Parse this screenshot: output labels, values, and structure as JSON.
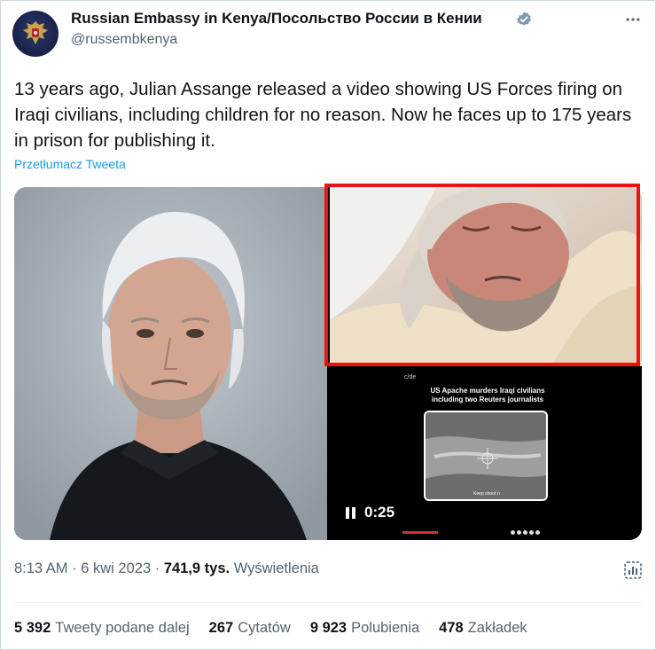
{
  "account": {
    "name": "Russian Embassy in Kenya/Посольство России в Кении",
    "handle": "@russembkenya",
    "verified_color": "#829aab"
  },
  "tweet": {
    "text": "13 years ago, Julian Assange released a video showing US Forces firing on Iraqi civilians, including children for no reason. Now he faces up to 175 years in prison for publishing it.",
    "translate_label": "Przetłumacz Tweeta"
  },
  "video": {
    "title_line1": "US Apache murders Iraqi civilians",
    "title_line2": "including two Reuters journalists",
    "caption": "Keep shoot´n",
    "elapsed": "0:25"
  },
  "meta": {
    "time": "8:13 AM",
    "date": "6 kwi 2023",
    "views_count": "741,9 tys.",
    "views_label": "Wyświetlenia"
  },
  "stats": [
    {
      "count": "5 392",
      "label": "Tweety podane dalej"
    },
    {
      "count": "267",
      "label": "Cytatów"
    },
    {
      "count": "9 923",
      "label": "Polubienia"
    },
    {
      "count": "478",
      "label": "Zakładek"
    }
  ],
  "colors": {
    "link": "#1d9bf0",
    "highlight_border": "#ee1111",
    "secondary_text": "#536471"
  }
}
